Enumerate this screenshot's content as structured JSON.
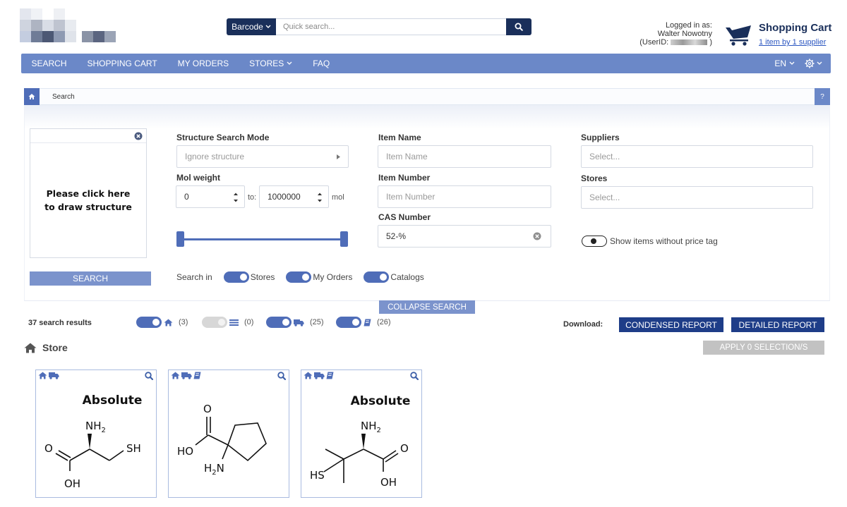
{
  "header": {
    "barcode_label": "Barcode",
    "quick_search_placeholder": "Quick search...",
    "login_line1": "Logged in as:",
    "login_user": "Walter Nowotny",
    "login_userid_prefix": "(UserID:",
    "login_userid_suffix": ")",
    "cart_title": "Shopping Cart",
    "cart_subtitle": "1 item by 1 supplier"
  },
  "nav": {
    "items": [
      "SEARCH",
      "SHOPPING CART",
      "MY ORDERS",
      "STORES",
      "FAQ"
    ],
    "language": "EN"
  },
  "breadcrumb": {
    "current": "Search",
    "help": "?"
  },
  "structure": {
    "prompt_line1": "Please click here",
    "prompt_line2": "to draw structure",
    "search_button": "SEARCH"
  },
  "form": {
    "structure_mode_label": "Structure Search Mode",
    "structure_mode_value": "Ignore structure",
    "mol_weight_label": "Mol weight",
    "mol_from": "0",
    "mol_to_label": "to:",
    "mol_to": "1000000",
    "mol_unit": "mol",
    "item_name_label": "Item Name",
    "item_name_placeholder": "Item Name",
    "item_number_label": "Item Number",
    "item_number_placeholder": "Item Number",
    "cas_label": "CAS Number",
    "cas_value": "52-%",
    "suppliers_label": "Suppliers",
    "suppliers_placeholder": "Select...",
    "stores_label": "Stores",
    "stores_placeholder": "Select...",
    "no_price_label": "Show items without price tag",
    "search_in_label": "Search in",
    "search_in_stores": "Stores",
    "search_in_orders": "My Orders",
    "search_in_catalogs": "Catalogs",
    "collapse_button": "COLLAPSE SEARCH"
  },
  "results": {
    "count_text": "37 search results",
    "filters": [
      {
        "icon": "home-icon",
        "count": "(3)",
        "enabled": true
      },
      {
        "icon": "list-icon",
        "count": "(0)",
        "enabled": false
      },
      {
        "icon": "truck-icon",
        "count": "(25)",
        "enabled": true
      },
      {
        "icon": "book-icon",
        "count": "(26)",
        "enabled": true
      }
    ],
    "download_label": "Download:",
    "condensed_report": "CONDENSED REPORT",
    "detailed_report": "DETAILED REPORT",
    "section_title": "Store",
    "apply_button": "APPLY 0 SELECTION/S"
  },
  "cards": [
    {
      "icons": [
        "home-icon",
        "truck-icon"
      ],
      "stereo_label": "Absolute",
      "atoms": {
        "amine": "NH",
        "amine_sub": "2",
        "oxygen": "O",
        "hydroxyl": "OH",
        "thiol": "SH"
      }
    },
    {
      "icons": [
        "home-icon",
        "truck-icon",
        "book-icon"
      ],
      "atoms": {
        "oxygen": "O",
        "hydroxyl": "HO",
        "amine_h": "H",
        "amine_sub": "2",
        "amine_n": "N"
      }
    },
    {
      "icons": [
        "home-icon",
        "truck-icon",
        "book-icon"
      ],
      "stereo_label": "Absolute",
      "atoms": {
        "amine": "NH",
        "amine_sub": "2",
        "oxygen": "O",
        "hydroxyl": "OH",
        "thiol": "HS"
      }
    }
  ],
  "colors": {
    "nav_bg": "#6b88c8",
    "dark_navy": "#1a2f5a",
    "toggle_blue": "#4f6db8",
    "report_blue": "#1e3d88"
  }
}
